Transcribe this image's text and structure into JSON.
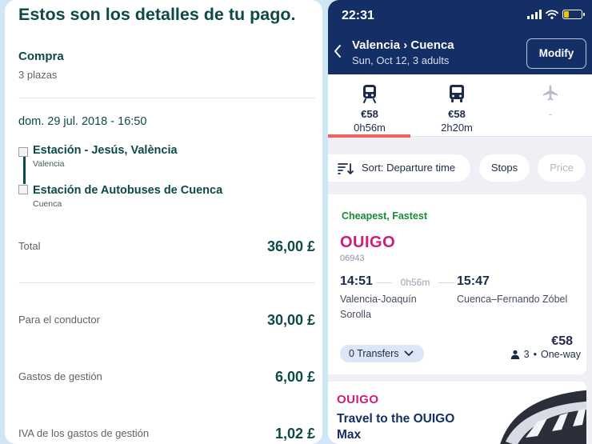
{
  "receipt": {
    "title": "Estos son los detalles de tu pago.",
    "purchase_label": "Compra",
    "seats": "3 plazas",
    "datetime": "dom. 29 jul. 2018 - 16:50",
    "origin": {
      "name": "Estación - Jesús, València",
      "city": "Valencia"
    },
    "destination": {
      "name": "Estación de Autobuses de Cuenca",
      "city": "Cuenca"
    },
    "total_label": "Total",
    "total_value": "36,00 £",
    "driver_label": "Para el conductor",
    "driver_value": "30,00 £",
    "fees_label": "Gastos de gestión",
    "fees_value": "6,00 £",
    "vat_label": "IVA de los gastos de gestión",
    "vat_value": "1,02 £"
  },
  "status_bar": {
    "time": "22:31"
  },
  "header": {
    "route": "Valencia › Cuenca",
    "subtitle": "Sun, Oct 12, 3 adults",
    "modify_label": "Modify"
  },
  "modes": [
    {
      "icon": "train-icon",
      "price": "€58",
      "duration": "0h56m",
      "active": true
    },
    {
      "icon": "bus-icon",
      "price": "€58",
      "duration": "2h20m",
      "active": false
    },
    {
      "icon": "plane-icon",
      "price": "-",
      "duration": "",
      "active": false
    }
  ],
  "filters": {
    "sort_label": "Sort: Departure time",
    "stops_label": "Stops",
    "price_label": "Price"
  },
  "result": {
    "tag": "Cheapest, Fastest",
    "operator": "OUIGO",
    "train_number": "06943",
    "departure_time": "14:51",
    "duration": "0h56m",
    "arrival_time": "15:47",
    "departure_station": "Valencia-Joaquín Sorolla",
    "arrival_station": "Cuenca–Fernando Zóbel",
    "price": "€58",
    "transfers": "0 Transfers",
    "passengers": "3",
    "trip_type": "One-way"
  },
  "promo": {
    "operator": "OUIGO",
    "headline": "Travel to the OUIGO Max"
  },
  "colors": {
    "receipt_text": "#0d4a45",
    "header_bg": "#132f66",
    "tab_accent": "#f25f5c",
    "ouigo_pink": "#cf1c7b",
    "tag_green": "#148a3a"
  }
}
